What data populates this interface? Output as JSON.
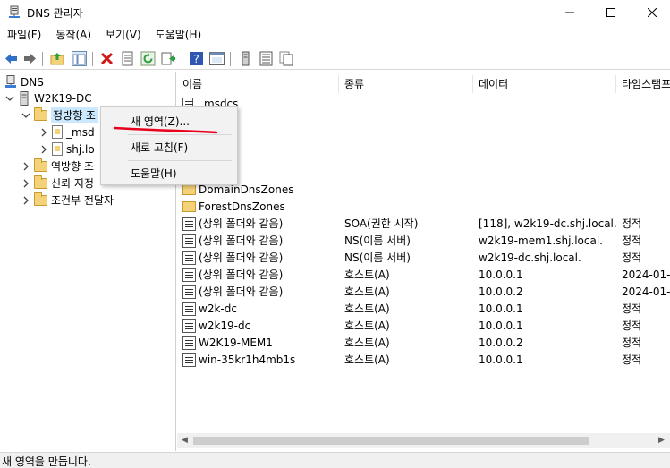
{
  "window": {
    "title": "DNS 관리자"
  },
  "menu": [
    "파일(F)",
    "동작(A)",
    "보기(V)",
    "도움말(H)"
  ],
  "tree": {
    "root": "DNS",
    "server": "W2K19-DC",
    "forward_zone": "정방향 조",
    "msdcs": "_msd",
    "shj": "shj.lo",
    "reverse_zone": "역방향 조",
    "trust": "신뢰 지정",
    "conditional": "조건부 전달자"
  },
  "list": {
    "columns": [
      "이름",
      "종류",
      "데이터",
      "타임스탬프"
    ],
    "rows": [
      {
        "icon": "zone-file-icon",
        "name": "_msdcs",
        "type": "",
        "data": "",
        "ts": ""
      },
      {
        "icon": "folder-icon",
        "name": "DomainDnsZones",
        "type": "",
        "data": "",
        "ts": ""
      },
      {
        "icon": "folder-icon",
        "name": "ForestDnsZones",
        "type": "",
        "data": "",
        "ts": ""
      },
      {
        "icon": "record-icon",
        "name": "(상위 폴더와 같음)",
        "type": "SOA(권한 시작)",
        "data": "[118], w2k19-dc.shj.local....",
        "ts": "정적"
      },
      {
        "icon": "record-icon",
        "name": "(상위 폴더와 같음)",
        "type": "NS(이름 서버)",
        "data": "w2k19-mem1.shj.local.",
        "ts": "정적"
      },
      {
        "icon": "record-icon",
        "name": "(상위 폴더와 같음)",
        "type": "NS(이름 서버)",
        "data": "w2k19-dc.shj.local.",
        "ts": "정적"
      },
      {
        "icon": "record-icon",
        "name": "(상위 폴더와 같음)",
        "type": "호스트(A)",
        "data": "10.0.0.1",
        "ts": "2024-01-"
      },
      {
        "icon": "record-icon",
        "name": "(상위 폴더와 같음)",
        "type": "호스트(A)",
        "data": "10.0.0.2",
        "ts": "2024-01-"
      },
      {
        "icon": "record-icon",
        "name": "w2k-dc",
        "type": "호스트(A)",
        "data": "10.0.0.1",
        "ts": "정적"
      },
      {
        "icon": "record-icon",
        "name": "w2k19-dc",
        "type": "호스트(A)",
        "data": "10.0.0.1",
        "ts": "정적"
      },
      {
        "icon": "record-icon",
        "name": "W2K19-MEM1",
        "type": "호스트(A)",
        "data": "10.0.0.2",
        "ts": "정적"
      },
      {
        "icon": "record-icon",
        "name": "win-35kr1h4mb1s",
        "type": "호스트(A)",
        "data": "10.0.0.1",
        "ts": "정적"
      }
    ]
  },
  "context_menu": [
    "새 영역(Z)...",
    "새로 고침(F)",
    "도움말(H)"
  ],
  "status": "새 영역을 만듭니다.",
  "colors": {
    "selection": "#cce8ff",
    "annotation": "#e8001c",
    "folder": "#f3d27a"
  }
}
